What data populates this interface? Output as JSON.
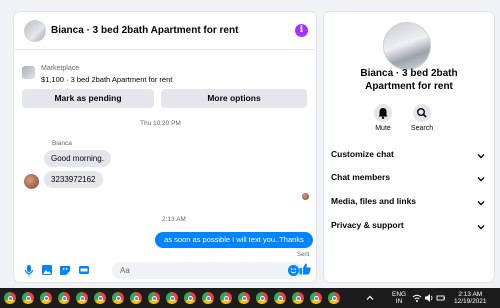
{
  "chat": {
    "title": "Bianca · 3 bed 2bath Apartment for rent",
    "info_glyph": "i",
    "marketplace_label": "Marketplace",
    "listing": "$1,100 · 3 bed 2bath Apartment for rent",
    "mark_pending_label": "Mark as pending",
    "more_options_label": "More options",
    "messages": {
      "timestamp_1": "Thu 10:20 PM",
      "sender_name": "Bianca",
      "incoming_1": "Good morning.",
      "incoming_2": "3233972162",
      "timestamp_2": "2:13 AM",
      "outgoing_1": "as soon as possible I will text you..Thanks",
      "status": "Sent"
    },
    "composer_placeholder": "Aa"
  },
  "info": {
    "name_line1": "Bianca · 3 bed 2bath",
    "name_line2": "Apartment for rent",
    "mute_label": "Mute",
    "search_label": "Search",
    "sections": [
      "Customize chat",
      "Chat members",
      "Media, files and links",
      "Privacy & support"
    ]
  },
  "taskbar": {
    "lang_line1": "ENG",
    "lang_line2": "IN",
    "time": "2:13 AM",
    "date": "12/19/2021"
  },
  "colors": {
    "accent": "#0084ff",
    "info_icon": "#a334fa",
    "bubble_in": "#e4e6eb",
    "taskbar": "#1c1c1c"
  },
  "icons": [
    "info-icon",
    "mic-icon",
    "image-icon",
    "sticker-icon",
    "gif-icon",
    "emoji-icon",
    "like-icon",
    "bell-icon",
    "search-icon",
    "chevron-down-icon",
    "chrome-icon"
  ]
}
